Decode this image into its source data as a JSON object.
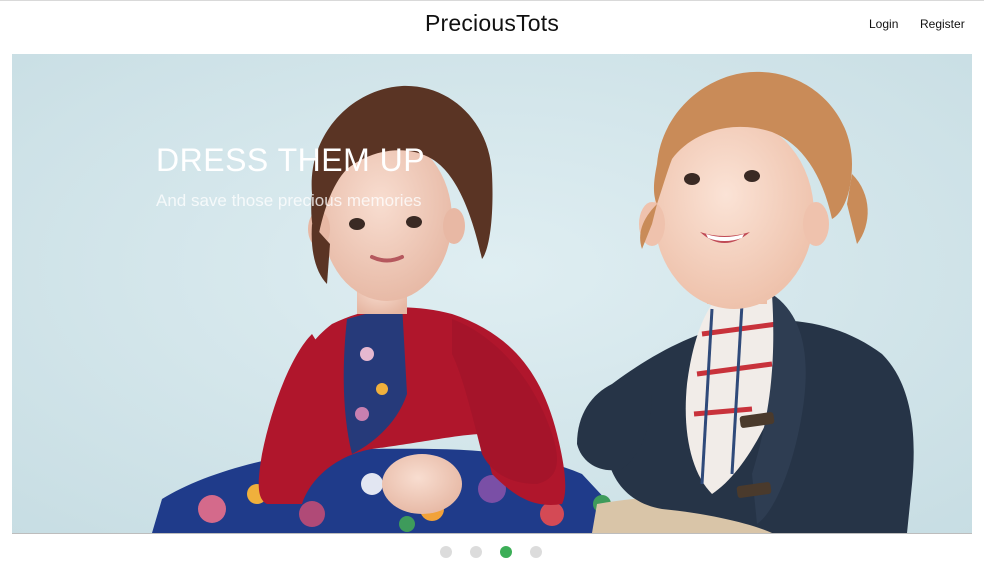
{
  "header": {
    "brand": "PreciousTots",
    "login_label": "Login",
    "register_label": "Register"
  },
  "hero": {
    "title": "DRESS THEM UP",
    "subtitle": "And save those precious memories",
    "background_color": "#d4e6eb"
  },
  "carousel": {
    "slide_count": 4,
    "active_index": 3,
    "active_color": "#3cae57",
    "inactive_color": "#dcdcdc"
  }
}
